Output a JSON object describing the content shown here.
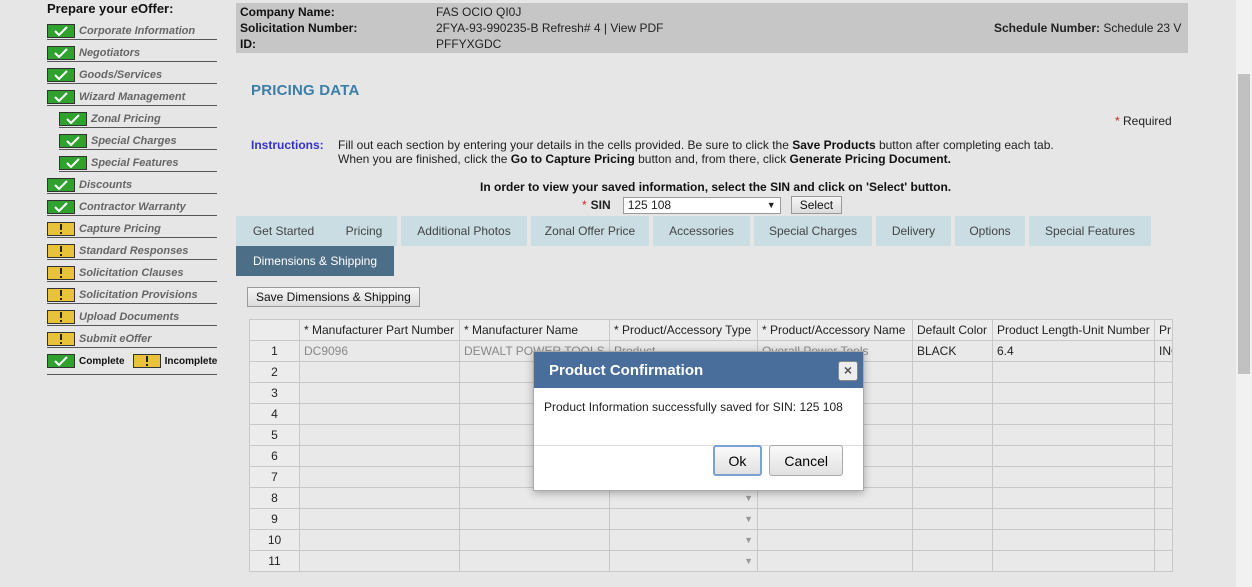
{
  "sidebar": {
    "title": "Prepare your eOffer:",
    "items": [
      {
        "label": "Corporate Information",
        "status": "complete",
        "sub": false
      },
      {
        "label": "Negotiators",
        "status": "complete",
        "sub": false
      },
      {
        "label": "Goods/Services",
        "status": "complete",
        "sub": false
      },
      {
        "label": "Wizard Management",
        "status": "complete",
        "sub": false
      },
      {
        "label": "Zonal Pricing",
        "status": "complete",
        "sub": true
      },
      {
        "label": "Special Charges",
        "status": "complete",
        "sub": true
      },
      {
        "label": "Special Features",
        "status": "complete",
        "sub": true
      },
      {
        "label": "Discounts",
        "status": "complete",
        "sub": false
      },
      {
        "label": "Contractor Warranty",
        "status": "complete",
        "sub": false
      },
      {
        "label": "Capture Pricing",
        "status": "incomplete",
        "sub": false
      },
      {
        "label": "Standard Responses",
        "status": "incomplete",
        "sub": false
      },
      {
        "label": "Solicitation Clauses",
        "status": "incomplete",
        "sub": false
      },
      {
        "label": "Solicitation Provisions",
        "status": "incomplete",
        "sub": false
      },
      {
        "label": "Upload Documents",
        "status": "incomplete",
        "sub": false
      },
      {
        "label": "Submit eOffer",
        "status": "incomplete",
        "sub": false
      }
    ],
    "legend_complete": "Complete",
    "legend_incomplete": "Incomplete"
  },
  "header": {
    "company_label": "Company Name:",
    "company_value": "FAS OCIO QI0J",
    "solicitation_label": "Solicitation Number:",
    "solicitation_value": "2FYA-93-990235-B Refresh# 4 |",
    "view_pdf": "View PDF",
    "id_label": "ID:",
    "id_value": "PFFYXGDC",
    "schedule_label": "Schedule Number:",
    "schedule_value": "Schedule 23 V"
  },
  "page": {
    "title": "PRICING DATA",
    "required_star": "*",
    "required": "Required",
    "instructions_label": "Instructions:",
    "instr_1a": "Fill out each section by entering your details in the cells provided. Be sure to click the ",
    "instr_1b": "Save Products",
    "instr_1c": " button after completing each tab.",
    "instr_2a": "When you are finished, click the ",
    "instr_2b": "Go to Capture Pricing",
    "instr_2c": " button and, from there, click ",
    "instr_2d": "Generate Pricing Document.",
    "sin_info": "In order to view your saved information, select the SIN and click on 'Select' button.",
    "sin_star": "*",
    "sin_label": "SIN",
    "sin_value": "125 108",
    "select_button": "Select",
    "save_dims_button": "Save Dimensions & Shipping"
  },
  "tabs": [
    "Get Started",
    "Pricing",
    "Additional Photos",
    "Zonal Offer Price",
    "Accessories",
    "Special Charges",
    "Delivery",
    "Options",
    "Special Features",
    "Dimensions & Shipping"
  ],
  "grid": {
    "headers": [
      "",
      "* Manufacturer Part Number",
      "* Manufacturer Name",
      "* Product/Accessory Type",
      "* Product/Accessory Name",
      "Default Color",
      "Product Length-Unit Number",
      "Pr"
    ],
    "row1": [
      "1",
      "DC9096",
      "DEWALT POWER TOOLS",
      "Product",
      "Overall Power Tools",
      "BLACK",
      "6.4",
      "INC"
    ],
    "rows": [
      "2",
      "3",
      "4",
      "5",
      "6",
      "7",
      "8",
      "9",
      "10",
      "11"
    ]
  },
  "modal": {
    "title": "Product Confirmation",
    "close": "×",
    "message": "Product Information successfully saved for SIN: 125 108",
    "ok": "Ok",
    "cancel": "Cancel"
  }
}
